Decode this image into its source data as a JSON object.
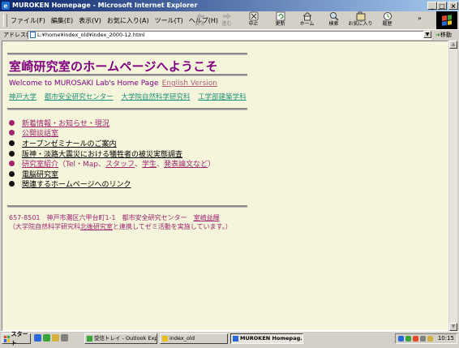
{
  "window": {
    "title": "MUROKEN Homepage - Microsoft Internet Explorer",
    "app_icon_glyph": "e",
    "controls": {
      "minimize": "_",
      "maximize": "□",
      "close": "×"
    }
  },
  "menu": {
    "items": [
      "ファイル(F)",
      "編集(E)",
      "表示(V)",
      "お気に入り(A)",
      "ツール(T)",
      "ヘルプ(H)"
    ]
  },
  "toolbar": {
    "buttons": [
      {
        "label": "戻る",
        "icon": "back-arrow-icon",
        "enabled": false
      },
      {
        "label": "進む",
        "icon": "forward-arrow-icon",
        "enabled": false
      },
      {
        "label": "中止",
        "icon": "stop-icon",
        "enabled": true
      },
      {
        "label": "更新",
        "icon": "refresh-icon",
        "enabled": true
      },
      {
        "label": "ホーム",
        "icon": "home-icon",
        "enabled": true
      },
      {
        "label": "検索",
        "icon": "search-icon",
        "enabled": true
      },
      {
        "label": "お気に入り",
        "icon": "favorites-icon",
        "enabled": true
      },
      {
        "label": "履歴",
        "icon": "history-icon",
        "enabled": true
      }
    ],
    "more": "»"
  },
  "address": {
    "label": "アドレス(D)",
    "url": "L:¥home¥index_old¥index_2000-12.html",
    "go_label": "移動"
  },
  "page": {
    "title": "室崎研究室のホームページへようこそ",
    "welcome": "Welcome to MUROSAKI Lab's Home Page",
    "english_link": "English Version",
    "org_links": [
      "神戸大学",
      "都市安全研究センター",
      "大学院自然科学研究科",
      "工学部建築学科"
    ],
    "menu": [
      {
        "bullet": "purple",
        "parts": [
          {
            "text": "新着情報・お知らせ・現況",
            "style": "link-purple"
          }
        ]
      },
      {
        "bullet": "purple",
        "parts": [
          {
            "text": "公開談話室",
            "style": "link-purple"
          }
        ]
      },
      {
        "bullet": "black",
        "parts": [
          {
            "text": "オープンゼミナールのご案内",
            "style": "link-black"
          }
        ]
      },
      {
        "bullet": "black",
        "parts": [
          {
            "text": "阪神・淡路大震災における犠牲者の被災実態調査",
            "style": "link-black"
          }
        ]
      },
      {
        "bullet": "purple",
        "parts": [
          {
            "text": "研究室紹介",
            "style": "link-purple"
          },
          {
            "text": "（Tel・Map、",
            "style": "plain-purple"
          },
          {
            "text": "スタッフ",
            "style": "link-purple"
          },
          {
            "text": "、",
            "style": "plain-purple"
          },
          {
            "text": "学生",
            "style": "link-purple"
          },
          {
            "text": "、",
            "style": "plain-purple"
          },
          {
            "text": "発表論文など",
            "style": "link-purple"
          },
          {
            "text": "）",
            "style": "plain-purple"
          }
        ]
      },
      {
        "bullet": "black",
        "parts": [
          {
            "text": "電脳研究室",
            "style": "link-black"
          }
        ]
      },
      {
        "bullet": "black",
        "parts": [
          {
            "text": "関連するホームページへのリンク",
            "style": "link-black"
          }
        ]
      }
    ],
    "footer": {
      "line1_prefix": "657-8501　神戸市灘区六甲台町1-1　都市安全研究センター　",
      "line1_link": "室崎益輝",
      "line2_prefix": "（大学院自然科学研究科",
      "line2_link": "北後研究室",
      "line2_suffix": "と連携してゼミ活動を実施しています。）"
    }
  },
  "taskbar": {
    "start_label": "スタート",
    "tasks": [
      {
        "label": "受信トレイ - Outlook Expr...",
        "active": false
      },
      {
        "label": "index_old",
        "active": false
      },
      {
        "label": "MUROKEN Homepag...",
        "active": true
      }
    ],
    "clock": "10:15"
  },
  "colors": {
    "title_purple": "#800080",
    "link_purple": "#a0236e",
    "link_teal": "#20907a",
    "page_background": "#f5f5dc"
  }
}
